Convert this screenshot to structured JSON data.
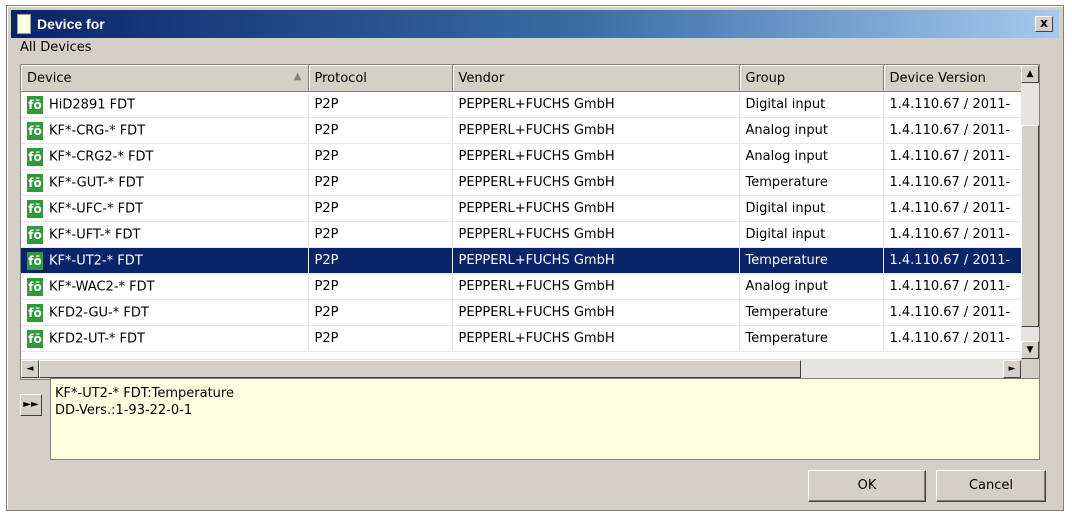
{
  "window": {
    "title": "Device for",
    "close_label": "x"
  },
  "breadcrumb": "All Devices",
  "table": {
    "columns": [
      "Device",
      "Protocol",
      "Vendor",
      "Group",
      "Device Version"
    ],
    "rows": [
      {
        "device": "HiD2891 FDT",
        "protocol": "P2P",
        "vendor": "PEPPERL+FUCHS GmbH",
        "group": "Digital input",
        "version": "1.4.110.67 / 2011-"
      },
      {
        "device": "KF*-CRG-* FDT",
        "protocol": "P2P",
        "vendor": "PEPPERL+FUCHS GmbH",
        "group": "Analog input",
        "version": "1.4.110.67 / 2011-"
      },
      {
        "device": "KF*-CRG2-* FDT",
        "protocol": "P2P",
        "vendor": "PEPPERL+FUCHS GmbH",
        "group": "Analog input",
        "version": "1.4.110.67 / 2011-"
      },
      {
        "device": "KF*-GUT-* FDT",
        "protocol": "P2P",
        "vendor": "PEPPERL+FUCHS GmbH",
        "group": "Temperature",
        "version": "1.4.110.67 / 2011-"
      },
      {
        "device": "KF*-UFC-* FDT",
        "protocol": "P2P",
        "vendor": "PEPPERL+FUCHS GmbH",
        "group": "Digital input",
        "version": "1.4.110.67 / 2011-"
      },
      {
        "device": "KF*-UFT-* FDT",
        "protocol": "P2P",
        "vendor": "PEPPERL+FUCHS GmbH",
        "group": "Digital input",
        "version": "1.4.110.67 / 2011-"
      },
      {
        "device": "KF*-UT2-* FDT",
        "protocol": "P2P",
        "vendor": "PEPPERL+FUCHS GmbH",
        "group": "Temperature",
        "version": "1.4.110.67 / 2011-"
      },
      {
        "device": "KF*-WAC2-* FDT",
        "protocol": "P2P",
        "vendor": "PEPPERL+FUCHS GmbH",
        "group": "Analog input",
        "version": "1.4.110.67 / 2011-"
      },
      {
        "device": "KFD2-GU-* FDT",
        "protocol": "P2P",
        "vendor": "PEPPERL+FUCHS GmbH",
        "group": "Temperature",
        "version": "1.4.110.67 / 2011-"
      },
      {
        "device": "KFD2-UT-* FDT",
        "protocol": "P2P",
        "vendor": "PEPPERL+FUCHS GmbH",
        "group": "Temperature",
        "version": "1.4.110.67 / 2011-"
      }
    ],
    "selected_index": 6
  },
  "info": {
    "line1": "KF*-UT2-* FDT:Temperature",
    "line2": "DD-Vers.:1-93-22-0-1"
  },
  "buttons": {
    "ok": "OK",
    "cancel": "Cancel"
  },
  "icons": {
    "device_icon_glyph": "fō",
    "expand_glyph": "►►"
  },
  "colors": {
    "selection": "#0a246a",
    "device_icon": "#2e9a3c",
    "info_background": "#ffffe1"
  }
}
